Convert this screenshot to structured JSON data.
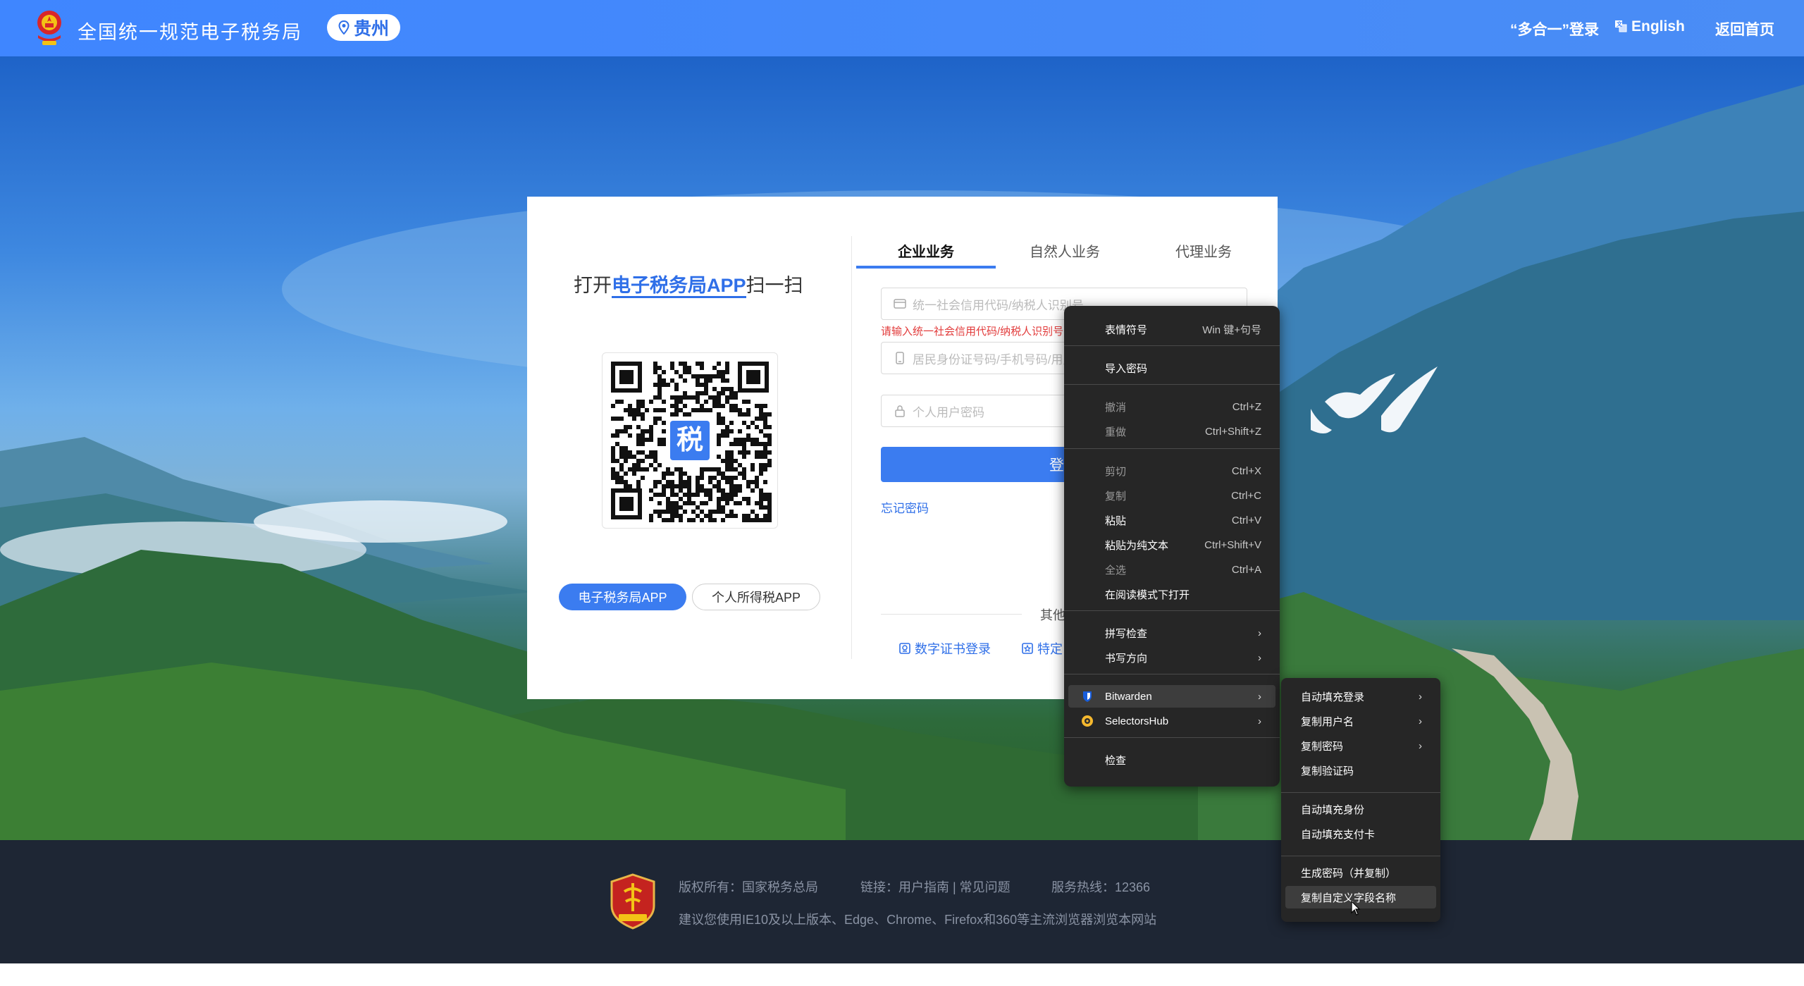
{
  "header": {
    "site_title": "全国统一规范电子税务局",
    "region": "贵州",
    "multi_login": "“多合一”登录",
    "language": "English",
    "home": "返回首页"
  },
  "qr_panel": {
    "title_prefix": "打开",
    "title_highlight": "电子税务局APP",
    "title_suffix": "扫一扫",
    "qr_center_char": "税",
    "app_buttons": [
      "电子税务局APP",
      "个人所得税APP"
    ]
  },
  "login": {
    "tabs": [
      "企业业务",
      "自然人业务",
      "代理业务"
    ],
    "credit_code_placeholder": "统一社会信用代码/纳税人识别号",
    "credit_code_error": "请输入统一社会信用代码/纳税人识别号",
    "id_placeholder": "居民身份证号码/手机号码/用户名",
    "password_placeholder": "个人用户密码",
    "login_button": "登录",
    "forgot": "忘记密码",
    "other_label": "其他",
    "alt_logins": [
      "数字证书登录",
      "特定"
    ]
  },
  "footer": {
    "copyright": "版权所有：国家税务总局",
    "links": "链接：用户指南 | 常见问题",
    "hotline": "服务热线：12366",
    "browser_tip": "建议您使用IE10及以上版本、Edge、Chrome、Firefox和360等主流浏览器浏览本网站"
  },
  "context_menu": {
    "items": [
      {
        "label": "表情符号",
        "shortcut": "Win 键+句号"
      },
      {
        "label": "导入密码"
      },
      {
        "label": "撤消",
        "shortcut": "Ctrl+Z"
      },
      {
        "label": "重做",
        "shortcut": "Ctrl+Shift+Z"
      },
      {
        "label": "剪切",
        "shortcut": "Ctrl+X"
      },
      {
        "label": "复制",
        "shortcut": "Ctrl+C"
      },
      {
        "label": "粘贴",
        "shortcut": "Ctrl+V"
      },
      {
        "label": "粘贴为纯文本",
        "shortcut": "Ctrl+Shift+V"
      },
      {
        "label": "全选",
        "shortcut": "Ctrl+A"
      },
      {
        "label": "在阅读模式下打开"
      },
      {
        "label": "拼写检查"
      },
      {
        "label": "书写方向"
      },
      {
        "label": "Bitwarden"
      },
      {
        "label": "SelectorsHub"
      },
      {
        "label": "检查"
      }
    ],
    "submenu": [
      "自动填充登录",
      "复制用户名",
      "复制密码",
      "复制验证码",
      "自动填充身份",
      "自动填充支付卡",
      "生成密码（并复制）",
      "复制自定义字段名称"
    ]
  },
  "colors": {
    "header_blue": "#3f86ff",
    "primary": "#3b7cf0",
    "error": "#e23b3b",
    "footer": "#1e2634",
    "menu_bg": "#262626"
  }
}
